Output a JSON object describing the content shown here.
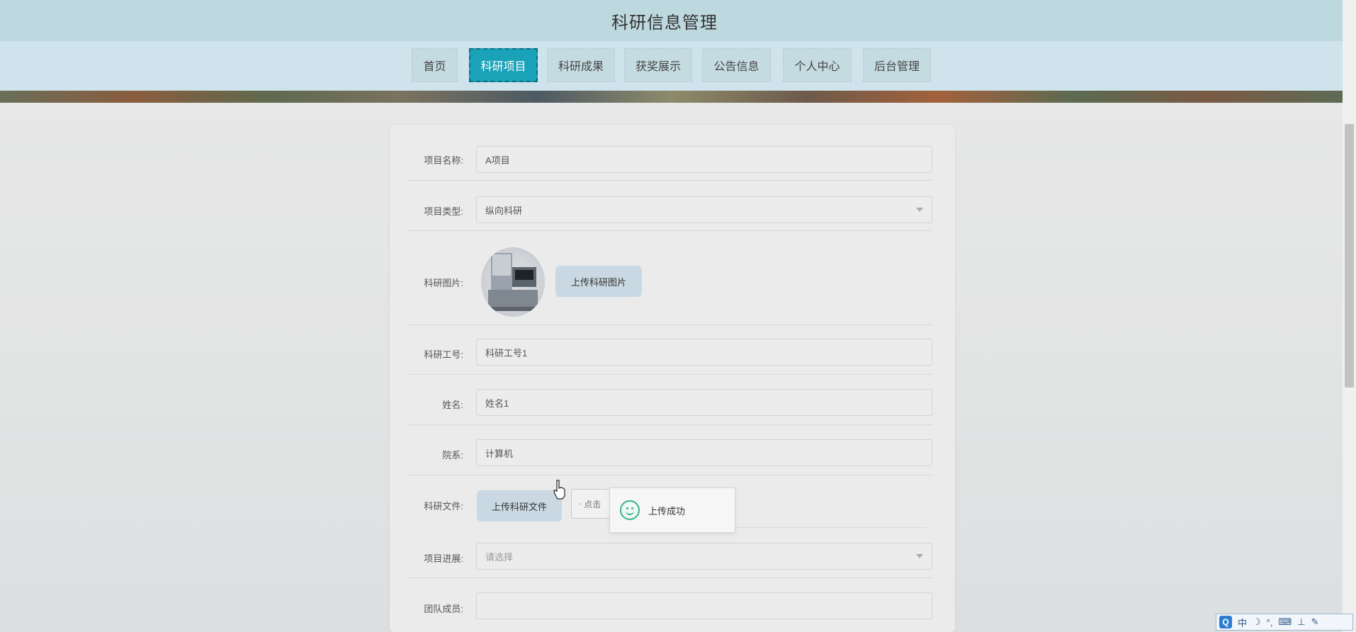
{
  "site": {
    "title": "科研信息管理"
  },
  "nav": {
    "tabs": [
      {
        "label": "首页"
      },
      {
        "label": "科研项目",
        "active": true
      },
      {
        "label": "科研成果"
      },
      {
        "label": "获奖展示"
      },
      {
        "label": "公告信息"
      },
      {
        "label": "个人中心"
      },
      {
        "label": "后台管理"
      }
    ]
  },
  "form": {
    "project_name": {
      "label": "项目名称:",
      "value": "A项目"
    },
    "project_type": {
      "label": "项目类型:",
      "value": "纵向科研"
    },
    "research_image": {
      "label": "科研图片:",
      "upload_label": "上传科研图片"
    },
    "staff_id": {
      "label": "科研工号:",
      "value": "科研工号1"
    },
    "name": {
      "label": "姓名:",
      "value": "姓名1"
    },
    "department": {
      "label": "院系:",
      "value": "计算机"
    },
    "research_file": {
      "label": "科研文件:",
      "upload_label": "上传科研文件",
      "area_text": "点击"
    },
    "progress": {
      "label": "项目进展:",
      "placeholder": "请选择"
    },
    "team_members": {
      "label": "团队成员:",
      "value": ""
    }
  },
  "toast": {
    "message": "上传成功",
    "icon": "smile-icon",
    "color": "#3bb38b"
  },
  "ime": {
    "logo": "Q",
    "mode": "中",
    "glyphs": [
      "☽",
      "°,",
      "⌨",
      "⊥",
      "✎"
    ]
  },
  "colors": {
    "accent": "#1aa2b8",
    "header_bg": "#bdd9df"
  }
}
